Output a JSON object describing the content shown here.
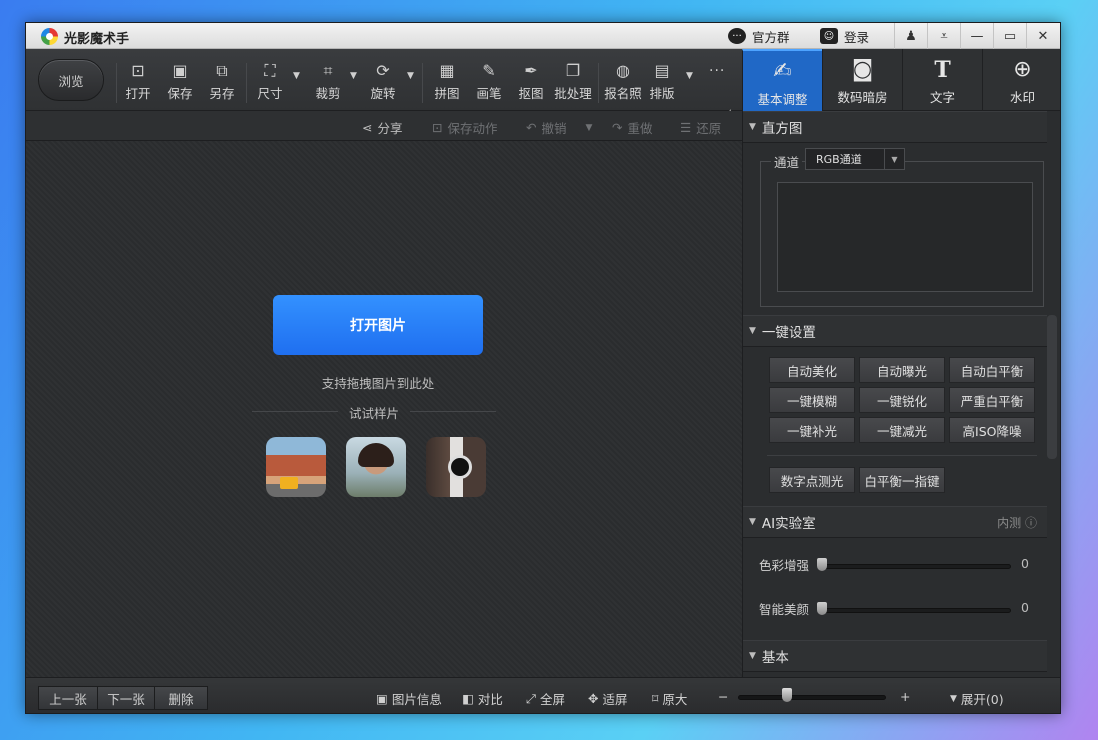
{
  "window": {
    "title": "光影魔术手",
    "group_label": "官方群",
    "login_label": "登录"
  },
  "toolbar": {
    "browse": "浏览",
    "tools": [
      {
        "label": "打开",
        "icon": "open-icon",
        "glyph": "⊡"
      },
      {
        "label": "保存",
        "icon": "save-icon",
        "glyph": "▣"
      },
      {
        "label": "另存",
        "icon": "save-as-icon",
        "glyph": "⧉"
      },
      {
        "label": "尺寸",
        "icon": "resize-icon",
        "glyph": "⛶"
      },
      {
        "label": "裁剪",
        "icon": "crop-icon",
        "glyph": "⌗"
      },
      {
        "label": "旋转",
        "icon": "rotate-icon",
        "glyph": "⟳"
      },
      {
        "label": "拼图",
        "icon": "collage-icon",
        "glyph": "▦"
      },
      {
        "label": "画笔",
        "icon": "brush-icon",
        "glyph": "✎"
      },
      {
        "label": "抠图",
        "icon": "cutout-icon",
        "glyph": "✒"
      },
      {
        "label": "批处理",
        "icon": "batch-icon",
        "glyph": "❐"
      },
      {
        "label": "报名照",
        "icon": "id-photo-icon",
        "glyph": "◍"
      },
      {
        "label": "排版",
        "icon": "layout-icon",
        "glyph": "▤"
      }
    ]
  },
  "right_tabs": [
    {
      "label": "基本调整",
      "icon": "basic-adjust-icon",
      "glyph": "✍"
    },
    {
      "label": "数码暗房",
      "icon": "darkroom-icon",
      "glyph": "◙"
    },
    {
      "label": "文字",
      "icon": "text-icon",
      "glyph": "T"
    },
    {
      "label": "水印",
      "icon": "watermark-icon",
      "glyph": "⊕"
    }
  ],
  "subbar": {
    "share": "分享",
    "save_action": "保存动作",
    "undo": "撤销",
    "redo": "重做",
    "restore": "还原"
  },
  "canvas": {
    "open_image": "打开图片",
    "drag_hint": "支持拖拽图片到此处",
    "sample_label": "试试样片"
  },
  "panel": {
    "histogram": {
      "title": "直方图",
      "channel_label": "通道",
      "channel_value": "RGB通道"
    },
    "one_click": {
      "title": "一键设置",
      "buttons": [
        "自动美化",
        "自动曝光",
        "自动白平衡",
        "一键模糊",
        "一键锐化",
        "严重白平衡",
        "一键补光",
        "一键减光",
        "高ISO降噪",
        "数字点测光",
        "白平衡一指键"
      ]
    },
    "ai_lab": {
      "title": "AI实验室",
      "beta": "内测",
      "sliders": [
        {
          "label": "色彩增强",
          "value": "0"
        },
        {
          "label": "智能美颜",
          "value": "0"
        }
      ]
    },
    "basic": {
      "title": "基本"
    }
  },
  "statusbar": {
    "prev": "上一张",
    "next": "下一张",
    "delete": "删除",
    "info": "图片信息",
    "compare": "对比",
    "fullscreen": "全屏",
    "fit": "适屏",
    "original": "原大",
    "zoom_minus": "−",
    "zoom_plus": "+",
    "expand": "展开(0)"
  },
  "colors": {
    "accent": "#2068c6",
    "open_button": "#1f6ff0"
  }
}
